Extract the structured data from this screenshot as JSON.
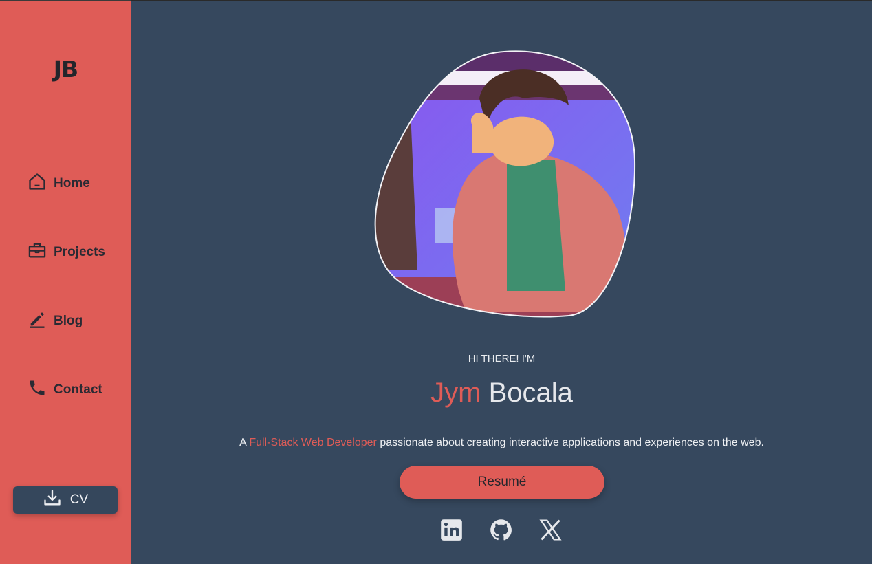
{
  "sidebar": {
    "logo": "JB",
    "items": [
      {
        "label": "Home",
        "icon": "home-icon"
      },
      {
        "label": "Projects",
        "icon": "briefcase-icon"
      },
      {
        "label": "Blog",
        "icon": "pencil-icon"
      },
      {
        "label": "Contact",
        "icon": "phone-icon"
      }
    ],
    "cv_label": "CV",
    "cv_icon": "download-icon"
  },
  "hero": {
    "greeting": "HI THERE! I'M",
    "first_name": "Jym",
    "last_name": "Bocala",
    "tagline_prefix": "A ",
    "tagline_highlight": "Full-Stack Web Developer",
    "tagline_suffix": " passionate about creating interactive applications and experiences on the web.",
    "resume_label": "Resumé",
    "avatar": "anime-style-portrait"
  },
  "socials": [
    "linkedin-icon",
    "github-icon",
    "x-icon"
  ],
  "colors": {
    "accent": "#df5c57",
    "background": "#36485e",
    "sidebar": "#df5c57",
    "dark_text": "#23252b"
  }
}
